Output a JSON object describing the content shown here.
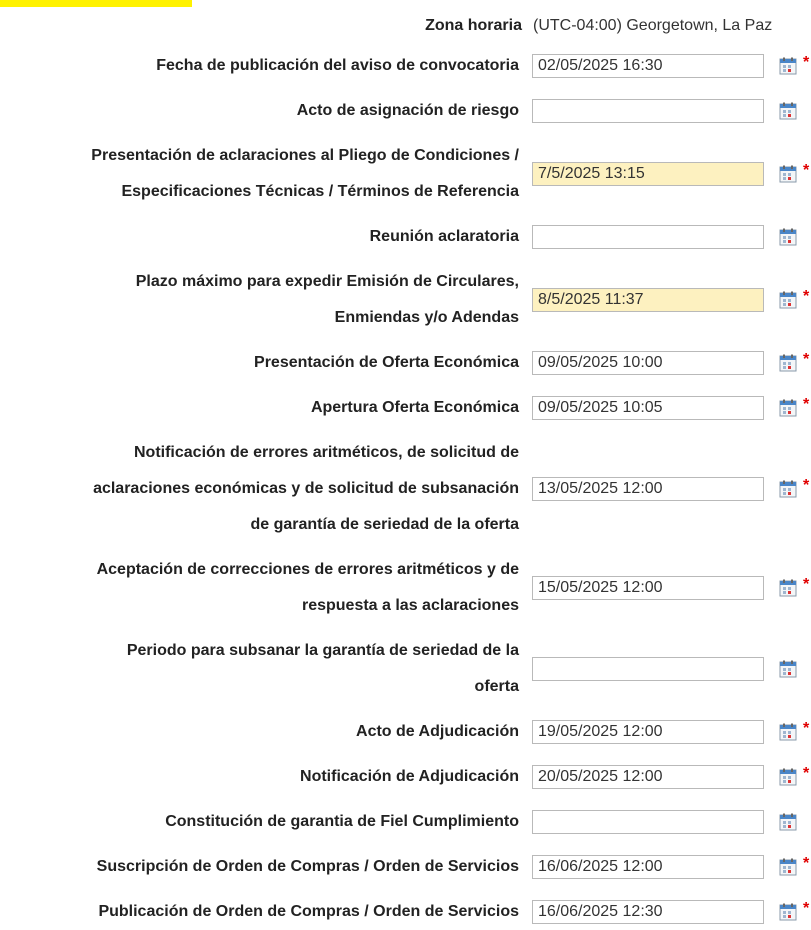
{
  "colors": {
    "highlight": "#fdf1c0",
    "required": "#e00000",
    "accent_bar": "#fff200"
  },
  "timezone": {
    "label": "Zona horaria",
    "value": "(UTC-04:00) Georgetown, La Paz"
  },
  "rows": [
    {
      "lines": [
        "Fecha de publicación del aviso de convocatoria"
      ],
      "value": "02/05/2025 16:30",
      "highlight": false,
      "required": true
    },
    {
      "lines": [
        "Acto de asignación de riesgo"
      ],
      "value": "",
      "highlight": false,
      "required": false
    },
    {
      "lines": [
        "Presentación de aclaraciones al Pliego de Condiciones /",
        "Especificaciones Técnicas / Términos de Referencia"
      ],
      "value": "7/5/2025 13:15",
      "highlight": true,
      "required": true
    },
    {
      "lines": [
        "Reunión aclaratoria"
      ],
      "value": "",
      "highlight": false,
      "required": false
    },
    {
      "lines": [
        "Plazo máximo para expedir Emisión de Circulares,",
        "Enmiendas y/o Adendas"
      ],
      "value": "8/5/2025 11:37",
      "highlight": true,
      "required": true
    },
    {
      "lines": [
        "Presentación de Oferta Económica"
      ],
      "value": "09/05/2025 10:00",
      "highlight": false,
      "required": true
    },
    {
      "lines": [
        "Apertura Oferta Económica"
      ],
      "value": "09/05/2025 10:05",
      "highlight": false,
      "required": true
    },
    {
      "lines": [
        "Notificación de errores aritméticos, de solicitud de",
        "aclaraciones económicas y de solicitud de subsanación",
        "de garantía de seriedad de la oferta"
      ],
      "value": "13/05/2025 12:00",
      "highlight": false,
      "required": true
    },
    {
      "lines": [
        "Aceptación de correcciones de errores aritméticos y de",
        "respuesta a las aclaraciones"
      ],
      "value": "15/05/2025 12:00",
      "highlight": false,
      "required": true
    },
    {
      "lines": [
        "Periodo para subsanar la garantía de seriedad de la",
        "oferta"
      ],
      "value": "",
      "highlight": false,
      "required": false
    },
    {
      "lines": [
        "Acto de Adjudicación"
      ],
      "value": "19/05/2025 12:00",
      "highlight": false,
      "required": true
    },
    {
      "lines": [
        "Notificación de Adjudicación"
      ],
      "value": "20/05/2025 12:00",
      "highlight": false,
      "required": true
    },
    {
      "lines": [
        "Constitución de garantia de Fiel Cumplimiento"
      ],
      "value": "",
      "highlight": false,
      "required": false
    },
    {
      "lines": [
        "Suscripción de Orden de Compras / Orden de Servicios"
      ],
      "value": "16/06/2025 12:00",
      "highlight": false,
      "required": true
    },
    {
      "lines": [
        "Publicación de Orden de Compras / Orden de Servicios"
      ],
      "value": "16/06/2025 12:30",
      "highlight": false,
      "required": true
    }
  ],
  "required_mark": "*"
}
